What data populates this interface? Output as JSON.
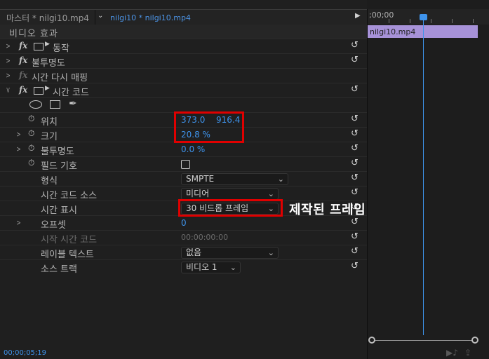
{
  "tabs": {
    "source_tab": "마스터 * nilgi10.mp4",
    "active_tab": "nilgi10 * nilgi10.mp4"
  },
  "panel_header": "비디오 효과",
  "effects": [
    {
      "label": "동작"
    },
    {
      "label": "불투명도"
    },
    {
      "label": "시간 다시 매핑"
    },
    {
      "label": "시간 코드"
    }
  ],
  "properties": {
    "position": {
      "label": "위치",
      "x": "373.0",
      "y": "916.4"
    },
    "scale": {
      "label": "크기",
      "value": "20.8 %"
    },
    "opacity": {
      "label": "불투명도",
      "value": "0.0 %"
    },
    "field_symbols": {
      "label": "필드 기호"
    },
    "format": {
      "label": "형식",
      "value": "SMPTE"
    },
    "timecode_source": {
      "label": "시간 코드 소스",
      "value": "미디어"
    },
    "time_display": {
      "label": "시간 표시",
      "value": "30 비드롭 프레임"
    },
    "offset": {
      "label": "오프셋",
      "value": "0"
    },
    "start_timecode": {
      "label": "시작 시간 코드",
      "value": "00:00:00:00"
    },
    "label_text": {
      "label": "레이블 텍스트",
      "value": "없음"
    },
    "source_track": {
      "label": "소스 트랙",
      "value": "비디오 1"
    }
  },
  "annotation": "제작된 프레임 선택",
  "current_time": "00;00;05;19",
  "timeline": {
    "ruler_time": ";00;00",
    "clip_name": "nilgi10.mp4"
  },
  "colors": {
    "accent_blue": "#3e93eb",
    "highlight_red": "#e00000",
    "clip_purple": "#a792d8"
  }
}
